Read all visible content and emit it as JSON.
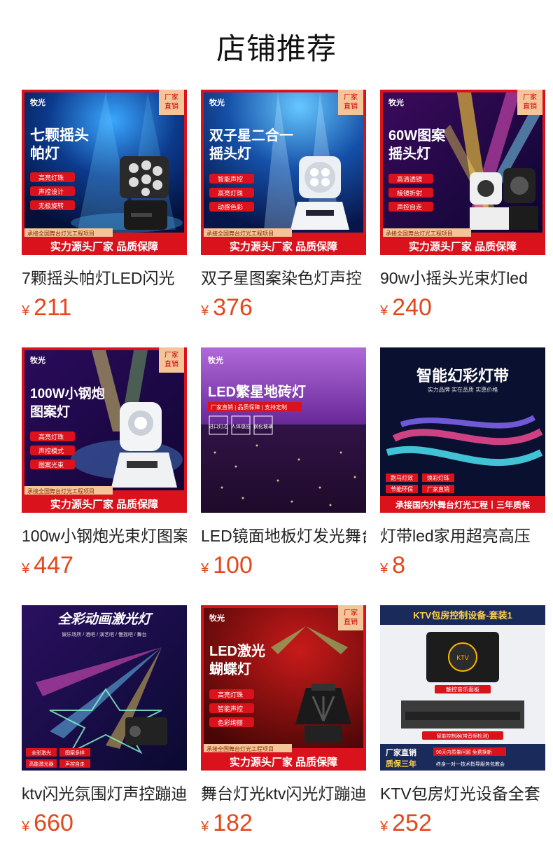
{
  "page": {
    "title": "店铺推荐",
    "currency": "¥",
    "colors": {
      "price": "#e4471c",
      "banner": "#d9121c",
      "badge": "#f5c59a"
    }
  },
  "products": [
    {
      "name": "7颗摇头帕灯LED闪光",
      "price": "211",
      "thumb": {
        "brand": "牧光",
        "badge": "厂家直销",
        "headline": "七颗摇头",
        "headline2": "帕灯",
        "features": [
          "高亮灯珠",
          "声控设计",
          "无极旋转"
        ],
        "strip": "承接全国舞台灯光工程项目",
        "banner": "实力源头厂家 品质保障"
      }
    },
    {
      "name": "双子星图案染色灯声控",
      "price": "376",
      "thumb": {
        "brand": "牧光",
        "badge": "厂家直销",
        "headline": "双子星二合一",
        "headline2": "摇头灯",
        "features": [
          "智能声控",
          "高亮灯珠",
          "动感色彩"
        ],
        "strip": "承接全国舞台灯光工程项目",
        "banner": "实力源头厂家 品质保障"
      }
    },
    {
      "name": "90w小摇头光束灯led",
      "price": "240",
      "thumb": {
        "brand": "牧光",
        "badge": "厂家直销",
        "headline": "60W图案",
        "headline2": "摇头灯",
        "features": [
          "高清透镜",
          "棱镜折射",
          "声控自走"
        ],
        "strip": "承接全国舞台灯光工程项目",
        "banner": "实力源头厂家 品质保障"
      }
    },
    {
      "name": "100w小钢炮光束灯图案",
      "price": "447",
      "thumb": {
        "brand": "牧光",
        "badge": "厂家直销",
        "headline": "100W小钢炮",
        "headline2": "图案灯",
        "features": [
          "高亮灯珠",
          "声控模式",
          "图案光束"
        ],
        "strip": "承接全国舞台灯光工程项目",
        "banner": "实力源头厂家 品质保障"
      }
    },
    {
      "name": "LED镜面地板灯发光舞台",
      "price": "100",
      "thumb": {
        "brand": "牧光",
        "headline": "LED繁星地砖灯",
        "subline": "厂家直销 | 品质保障 | 支持定制",
        "tags": [
          "进口灯芯",
          "人体感应",
          "钢化玻璃"
        ]
      }
    },
    {
      "name": "灯带led家用超亮高压",
      "price": "8",
      "thumb": {
        "headline": "智能幻彩灯带",
        "subline": "实力品牌 实在品质 实惠价格",
        "tags": [
          "跑马灯效",
          "焕彩灯珠",
          "节能环保",
          "厂家直销"
        ],
        "banner": "承接国内外舞台灯光工程丨三年质保"
      }
    },
    {
      "name": "ktv闪光氛围灯声控蹦迪",
      "price": "660",
      "thumb": {
        "headline": "全彩动画激光灯",
        "subline": "娱乐场所 / 酒吧 / 演艺吧 / 慢摇吧 / 舞台",
        "tags": [
          "全彩激光",
          "图案多样",
          "高能激光器",
          "声控自走"
        ]
      }
    },
    {
      "name": "舞台灯光ktv闪光灯蹦迪",
      "price": "182",
      "thumb": {
        "brand": "牧光",
        "badge": "厂家直销",
        "headline": "LED激光",
        "headline2": "蝴蝶灯",
        "features": [
          "高亮灯珠",
          "智能声控",
          "色彩绚丽"
        ],
        "strip": "承接全国舞台灯光工程项目",
        "banner": "实力源头厂家 品质保障"
      }
    },
    {
      "name": "KTV包房灯光设备全套",
      "price": "252",
      "thumb": {
        "headline": "KTV包房控制设备-套装1",
        "label1": "触控音乐面板",
        "label2": "智能控制器(带音频检测)",
        "banner": "厂家直销",
        "banner2": "质保三年",
        "note1": "90天内质量问题 免费换新",
        "note2": "终身一对一技术指导服务包教会"
      }
    }
  ]
}
